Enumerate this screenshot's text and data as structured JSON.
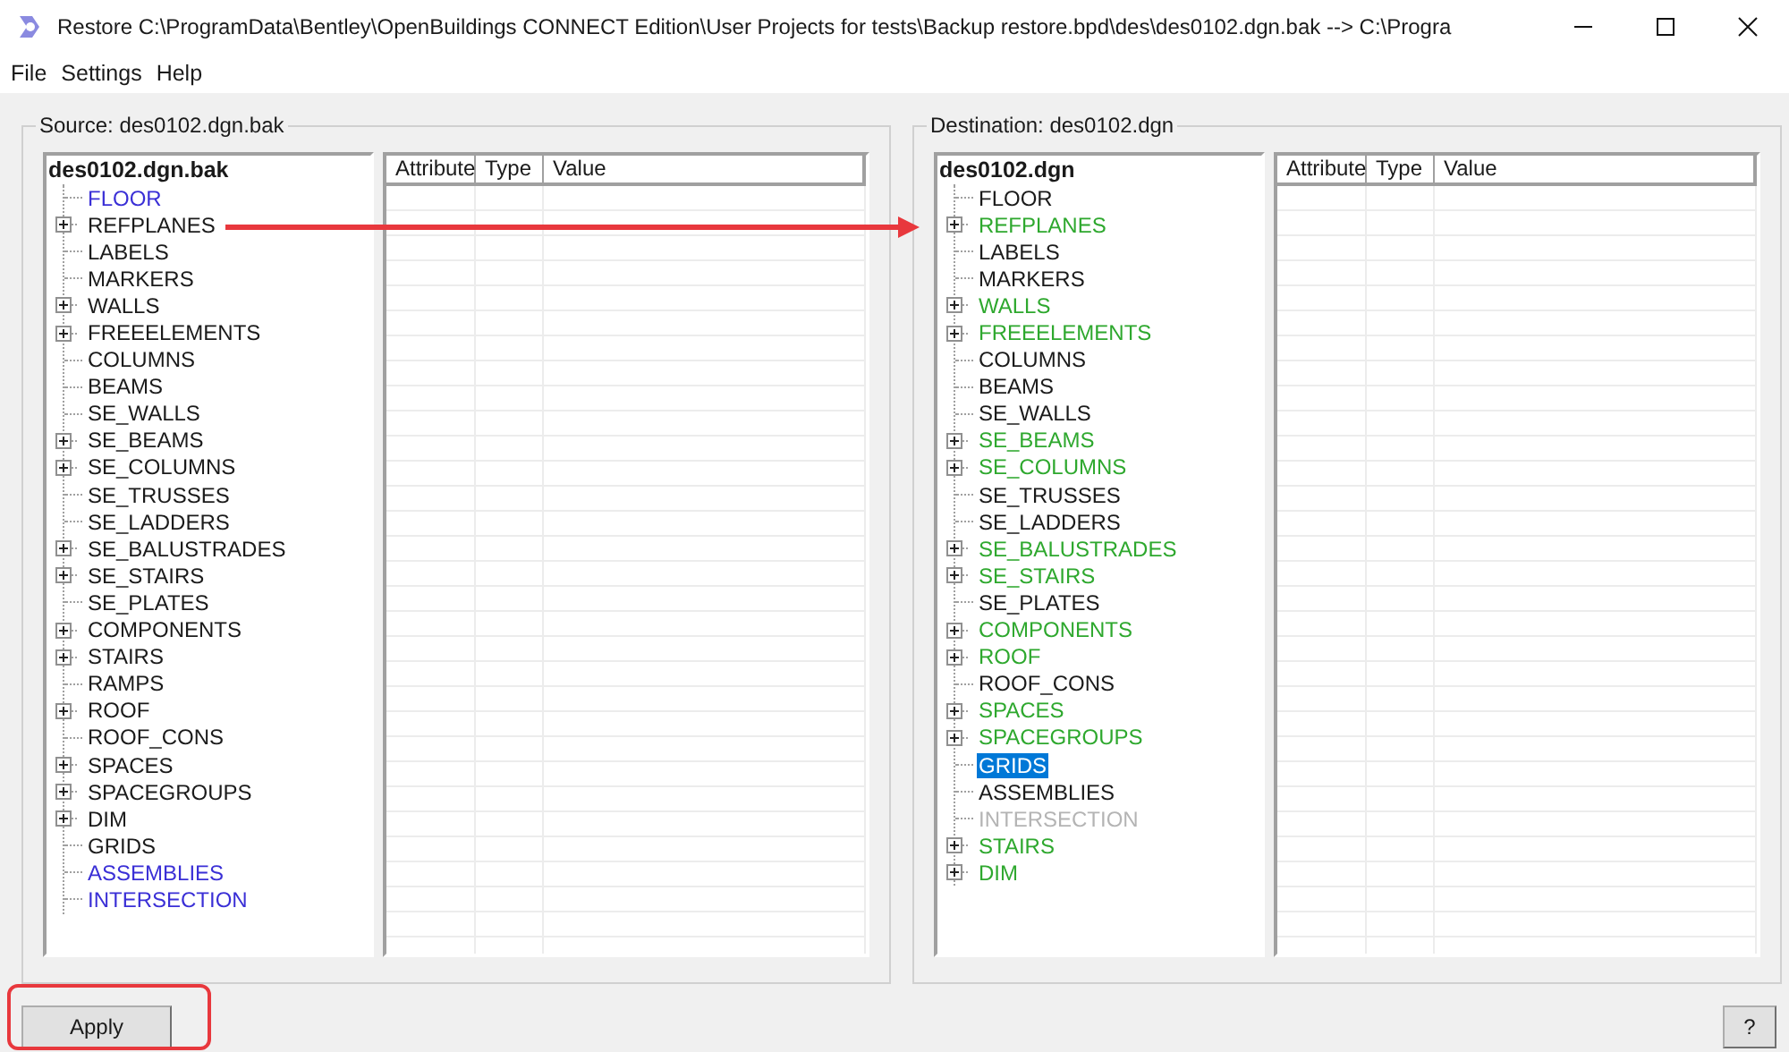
{
  "window": {
    "title": "Restore C:\\ProgramData\\Bentley\\OpenBuildings CONNECT Edition\\User Projects for tests\\Backup restore.bpd\\des\\des0102.dgn.bak --> C:\\Progra"
  },
  "menu": [
    "File",
    "Settings",
    "Help"
  ],
  "panels": [
    {
      "legend": "Source: des0102.dgn.bak",
      "root": "des0102.dgn.bak",
      "columns": [
        "Attribute",
        "Type",
        "Value"
      ],
      "items": [
        {
          "label": "FLOOR",
          "expandable": false,
          "color": "#3a2fd6",
          "selected": false
        },
        {
          "label": "REFPLANES",
          "expandable": true,
          "color": "#1a1a1a",
          "selected": false
        },
        {
          "label": "LABELS",
          "expandable": false,
          "color": "#1a1a1a",
          "selected": false
        },
        {
          "label": "MARKERS",
          "expandable": false,
          "color": "#1a1a1a",
          "selected": false
        },
        {
          "label": "WALLS",
          "expandable": true,
          "color": "#1a1a1a",
          "selected": false
        },
        {
          "label": "FREEELEMENTS",
          "expandable": true,
          "color": "#1a1a1a",
          "selected": false
        },
        {
          "label": "COLUMNS",
          "expandable": false,
          "color": "#1a1a1a",
          "selected": false
        },
        {
          "label": "BEAMS",
          "expandable": false,
          "color": "#1a1a1a",
          "selected": false
        },
        {
          "label": "SE_WALLS",
          "expandable": false,
          "color": "#1a1a1a",
          "selected": false
        },
        {
          "label": "SE_BEAMS",
          "expandable": true,
          "color": "#1a1a1a",
          "selected": false
        },
        {
          "label": "SE_COLUMNS",
          "expandable": true,
          "color": "#1a1a1a",
          "selected": false
        },
        {
          "label": "SE_TRUSSES",
          "expandable": false,
          "color": "#1a1a1a",
          "selected": false
        },
        {
          "label": "SE_LADDERS",
          "expandable": false,
          "color": "#1a1a1a",
          "selected": false
        },
        {
          "label": "SE_BALUSTRADES",
          "expandable": true,
          "color": "#1a1a1a",
          "selected": false
        },
        {
          "label": "SE_STAIRS",
          "expandable": true,
          "color": "#1a1a1a",
          "selected": false
        },
        {
          "label": "SE_PLATES",
          "expandable": false,
          "color": "#1a1a1a",
          "selected": false
        },
        {
          "label": "COMPONENTS",
          "expandable": true,
          "color": "#1a1a1a",
          "selected": false
        },
        {
          "label": "STAIRS",
          "expandable": true,
          "color": "#1a1a1a",
          "selected": false
        },
        {
          "label": "RAMPS",
          "expandable": false,
          "color": "#1a1a1a",
          "selected": false
        },
        {
          "label": "ROOF",
          "expandable": true,
          "color": "#1a1a1a",
          "selected": false
        },
        {
          "label": "ROOF_CONS",
          "expandable": false,
          "color": "#1a1a1a",
          "selected": false
        },
        {
          "label": "SPACES",
          "expandable": true,
          "color": "#1a1a1a",
          "selected": false
        },
        {
          "label": "SPACEGROUPS",
          "expandable": true,
          "color": "#1a1a1a",
          "selected": false
        },
        {
          "label": "DIM",
          "expandable": true,
          "color": "#1a1a1a",
          "selected": false
        },
        {
          "label": "GRIDS",
          "expandable": false,
          "color": "#1a1a1a",
          "selected": false
        },
        {
          "label": "ASSEMBLIES",
          "expandable": false,
          "color": "#3a2fd6",
          "selected": false
        },
        {
          "label": "INTERSECTION",
          "expandable": false,
          "color": "#3a2fd6",
          "selected": false
        }
      ]
    },
    {
      "legend": "Destination: des0102.dgn",
      "root": "des0102.dgn",
      "columns": [
        "Attribute",
        "Type",
        "Value"
      ],
      "items": [
        {
          "label": "FLOOR",
          "expandable": false,
          "color": "#1a1a1a",
          "selected": false
        },
        {
          "label": "REFPLANES",
          "expandable": true,
          "color": "#2ea82e",
          "selected": false
        },
        {
          "label": "LABELS",
          "expandable": false,
          "color": "#1a1a1a",
          "selected": false
        },
        {
          "label": "MARKERS",
          "expandable": false,
          "color": "#1a1a1a",
          "selected": false
        },
        {
          "label": "WALLS",
          "expandable": true,
          "color": "#2ea82e",
          "selected": false
        },
        {
          "label": "FREEELEMENTS",
          "expandable": true,
          "color": "#2ea82e",
          "selected": false
        },
        {
          "label": "COLUMNS",
          "expandable": false,
          "color": "#1a1a1a",
          "selected": false
        },
        {
          "label": "BEAMS",
          "expandable": false,
          "color": "#1a1a1a",
          "selected": false
        },
        {
          "label": "SE_WALLS",
          "expandable": false,
          "color": "#1a1a1a",
          "selected": false
        },
        {
          "label": "SE_BEAMS",
          "expandable": true,
          "color": "#2ea82e",
          "selected": false
        },
        {
          "label": "SE_COLUMNS",
          "expandable": true,
          "color": "#2ea82e",
          "selected": false
        },
        {
          "label": "SE_TRUSSES",
          "expandable": false,
          "color": "#1a1a1a",
          "selected": false
        },
        {
          "label": "SE_LADDERS",
          "expandable": false,
          "color": "#1a1a1a",
          "selected": false
        },
        {
          "label": "SE_BALUSTRADES",
          "expandable": true,
          "color": "#2ea82e",
          "selected": false
        },
        {
          "label": "SE_STAIRS",
          "expandable": true,
          "color": "#2ea82e",
          "selected": false
        },
        {
          "label": "SE_PLATES",
          "expandable": false,
          "color": "#1a1a1a",
          "selected": false
        },
        {
          "label": "COMPONENTS",
          "expandable": true,
          "color": "#2ea82e",
          "selected": false
        },
        {
          "label": "ROOF",
          "expandable": true,
          "color": "#2ea82e",
          "selected": false
        },
        {
          "label": "ROOF_CONS",
          "expandable": false,
          "color": "#1a1a1a",
          "selected": false
        },
        {
          "label": "SPACES",
          "expandable": true,
          "color": "#2ea82e",
          "selected": false
        },
        {
          "label": "SPACEGROUPS",
          "expandable": true,
          "color": "#2ea82e",
          "selected": false
        },
        {
          "label": "GRIDS",
          "expandable": false,
          "selected": true
        },
        {
          "label": "ASSEMBLIES",
          "expandable": false,
          "color": "#1a1a1a",
          "selected": false
        },
        {
          "label": "INTERSECTION",
          "expandable": false,
          "color": "#b4b4b4",
          "selected": false
        },
        {
          "label": "STAIRS",
          "expandable": true,
          "color": "#2ea82e",
          "selected": false
        },
        {
          "label": "DIM",
          "expandable": true,
          "color": "#2ea82e",
          "selected": false
        }
      ]
    }
  ],
  "buttons": {
    "apply": "Apply",
    "help": "?"
  }
}
